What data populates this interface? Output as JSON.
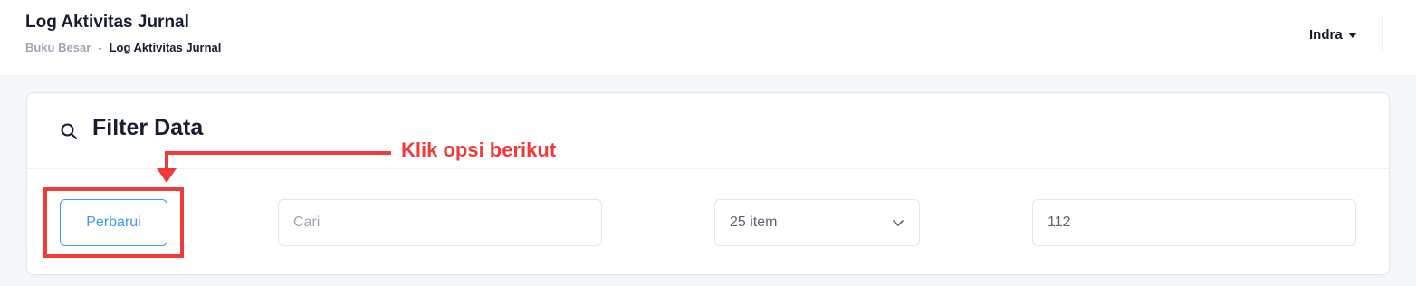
{
  "header": {
    "title": "Log Aktivitas Jurnal",
    "breadcrumb": {
      "parent": "Buku Besar",
      "separator": "-",
      "current": "Log Aktivitas Jurnal"
    },
    "user": "Indra"
  },
  "filter": {
    "title": "Filter Data",
    "refresh_label": "Perbarui",
    "search_placeholder": "Cari",
    "page_size_value": "25 item",
    "total_value": "112"
  },
  "annotation": {
    "text": "Klik opsi berikut",
    "color": "#f23a3a"
  },
  "colors": {
    "accent": "#3e97ff",
    "text_dark": "#181c32",
    "text_muted": "#a1a5b7"
  },
  "icons": [
    "search-icon",
    "chevron-down-icon",
    "caret-down-icon"
  ]
}
